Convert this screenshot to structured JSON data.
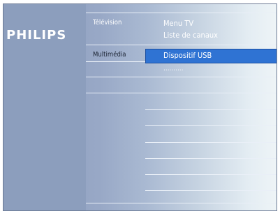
{
  "brand": {
    "logo_text": "PHILIPS"
  },
  "menu": {
    "level1": [
      {
        "label": "Télévision",
        "selected": false
      },
      {
        "label": "Multimédia",
        "selected": true
      }
    ],
    "level2": [
      {
        "label": "Menu TV",
        "selected": false
      },
      {
        "label": "Liste de canaux",
        "selected": false
      },
      {
        "label": "Dispositif USB",
        "selected": true
      },
      {
        "label": "..........",
        "selected": false
      }
    ]
  },
  "colors": {
    "panel": "#8c9ebd",
    "highlight": "#2f73d3",
    "gradient_end": "#eef4f7"
  }
}
